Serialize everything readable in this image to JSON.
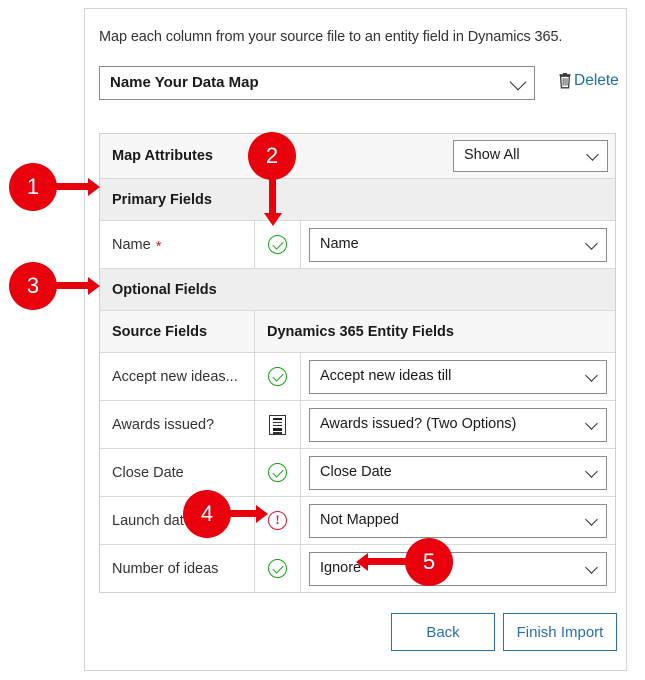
{
  "dialog": {
    "intro": "Map each column from your source file to an entity field in Dynamics 365.",
    "data_map": {
      "value": "Name Your Data Map",
      "chevron_icon": "chevron-down-icon"
    },
    "delete": {
      "label": "Delete",
      "icon": "trash-icon",
      "color": "#1d6ea8"
    },
    "map_attributes": {
      "label": "Map Attributes",
      "filter_value": "Show All"
    },
    "sections": {
      "primary": "Primary Fields",
      "optional": "Optional Fields"
    },
    "columns": {
      "source": "Source Fields",
      "target": "Dynamics 365 Entity Fields"
    },
    "primary_rows": [
      {
        "source": "Name",
        "required": "*",
        "status_icon": "check-circle-icon",
        "status": "ok",
        "target": "Name"
      }
    ],
    "optional_rows": [
      {
        "source": "Accept new ideas...",
        "status_icon": "check-circle-icon",
        "status": "ok",
        "target": "Accept new ideas till"
      },
      {
        "source": "Awards issued?",
        "status_icon": "list-document-icon",
        "status": "list",
        "target": "Awards issued? (Two Options)"
      },
      {
        "source": "Close Date",
        "status_icon": "check-circle-icon",
        "status": "ok",
        "target": "Close Date"
      },
      {
        "source": "Launch date",
        "status_icon": "warning-circle-icon",
        "status": "warn",
        "target": "Not Mapped"
      },
      {
        "source": "Number of ideas",
        "status_icon": "check-circle-icon",
        "status": "ok",
        "target": "Ignore"
      }
    ],
    "buttons": {
      "back": "Back",
      "finish": "Finish Import"
    }
  },
  "annotations": {
    "color": "#e8000d",
    "callouts": [
      {
        "number": "1",
        "target": "Primary Fields section header"
      },
      {
        "number": "2",
        "target": "Name row mapping status icon"
      },
      {
        "number": "3",
        "target": "Optional Fields section header"
      },
      {
        "number": "4",
        "target": "Launch date warning status icon"
      },
      {
        "number": "5",
        "target": "Ignore target value"
      }
    ]
  }
}
